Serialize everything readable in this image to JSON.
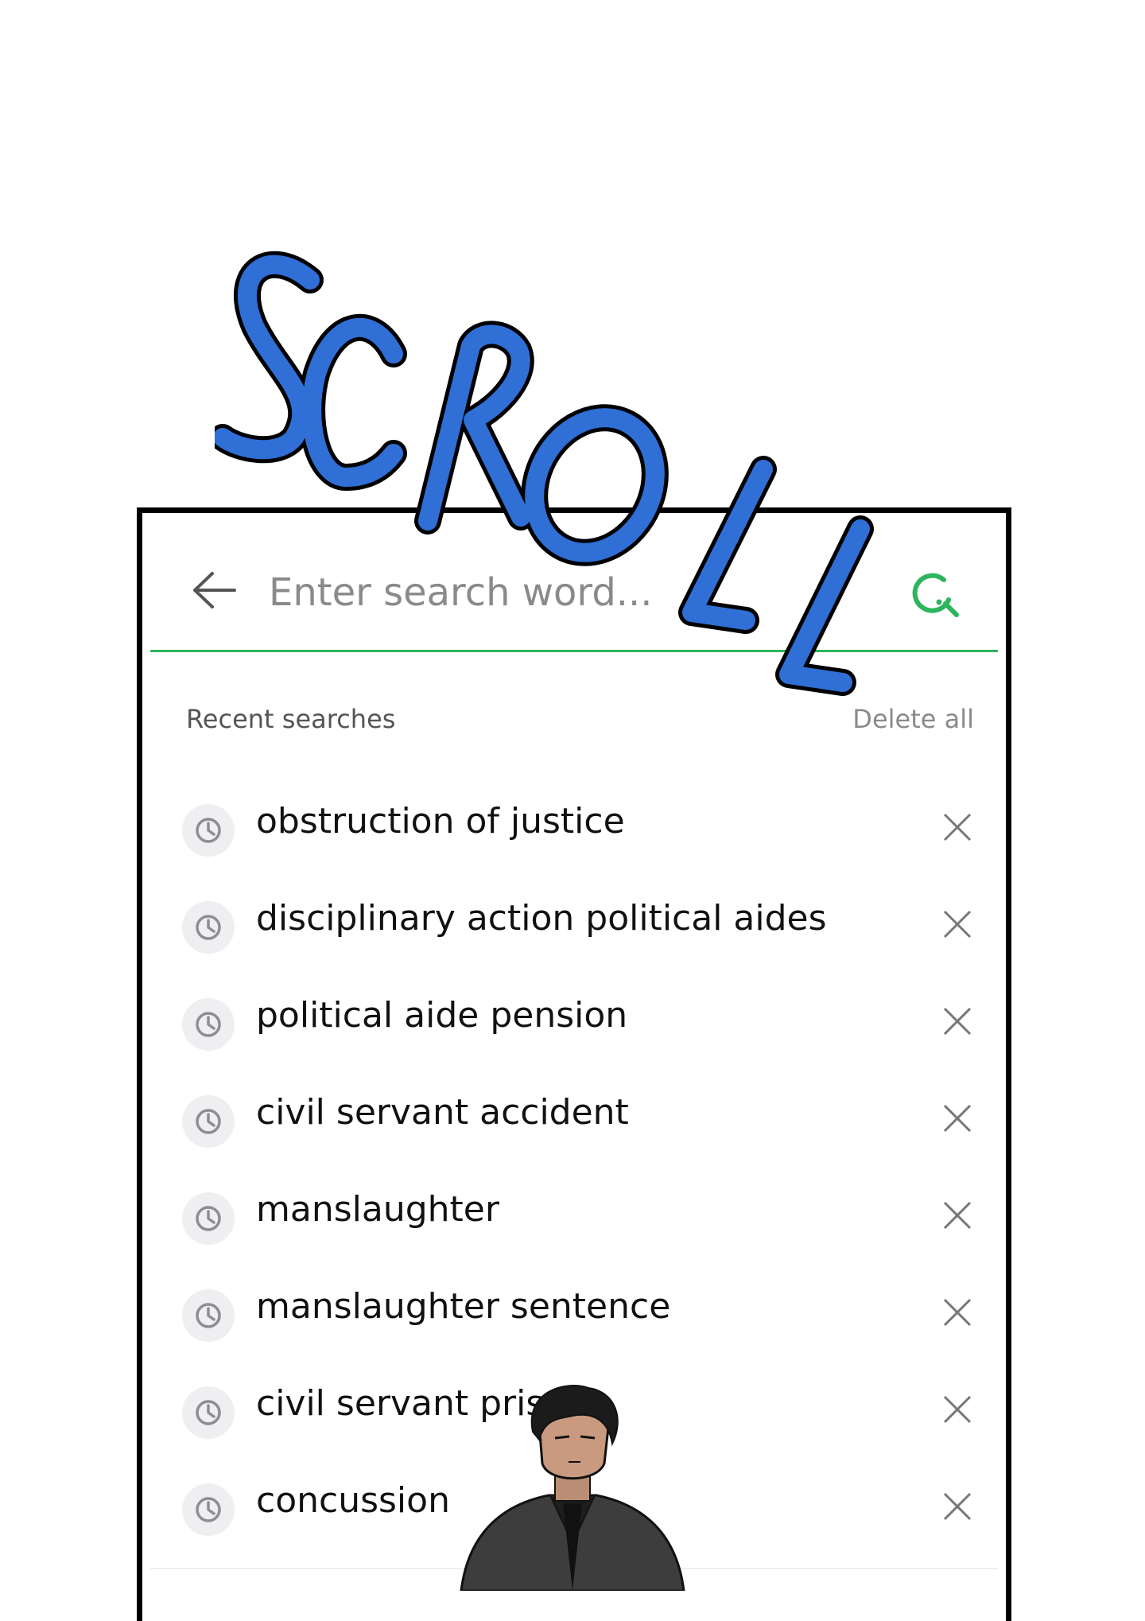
{
  "overlay": {
    "sfx_text": "SCROLL",
    "sfx_color": "#2f6fd6"
  },
  "search": {
    "placeholder": "Enter search word...",
    "accent_color": "#2db55d",
    "back_icon": "arrow-left-icon",
    "search_icon": "search-icon"
  },
  "recent": {
    "title": "Recent searches",
    "delete_all_label": "Delete all",
    "item_icon": "clock-icon",
    "remove_icon": "close-icon",
    "items": [
      {
        "label": "obstruction of justice"
      },
      {
        "label": "disciplinary action political aides"
      },
      {
        "label": "political aide pension"
      },
      {
        "label": "civil servant accident"
      },
      {
        "label": "manslaughter"
      },
      {
        "label": "manslaughter sentence"
      },
      {
        "label": "civil servant prison"
      },
      {
        "label": "concussion"
      }
    ]
  }
}
